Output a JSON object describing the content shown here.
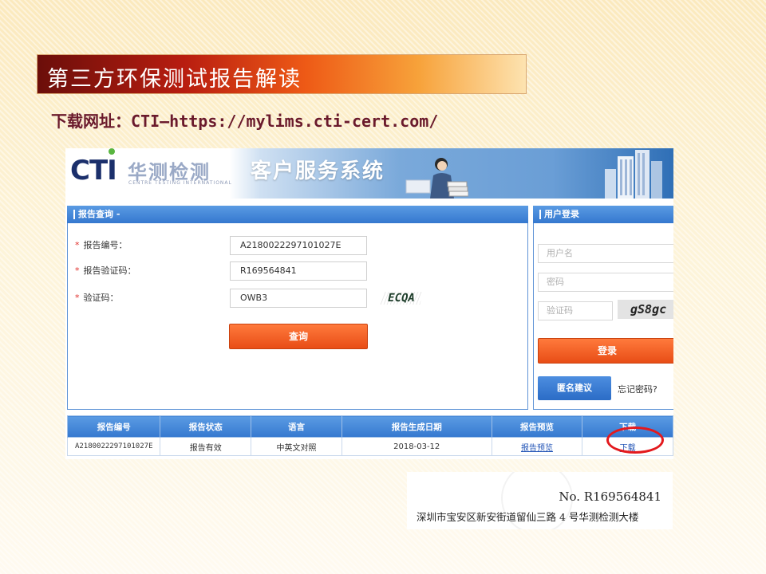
{
  "slide": {
    "title": "第三方环保测试报告解读",
    "subtitle": "下载网址：CTI—https://mylims.cti-cert.com/"
  },
  "site": {
    "logo_text": "CTI",
    "logo_cn": "华测检测",
    "logo_en": "CENTRE TESTING INTERNATIONAL",
    "banner_title": "客户服务系统"
  },
  "report_query": {
    "header": "报告查询 -",
    "fields": [
      {
        "label": "报告编号：",
        "value": "A2180022297101027E"
      },
      {
        "label": "报告验证码：",
        "value": "R169564841"
      },
      {
        "label": "验证码：",
        "value": "OWB3"
      }
    ],
    "captcha_text": "ECQA",
    "submit_label": "查询"
  },
  "user_login": {
    "header": "用户登录",
    "username_placeholder": "用户名",
    "password_placeholder": "密码",
    "captcha_placeholder": "验证码",
    "captcha_text": "gS8gc",
    "login_label": "登录",
    "anonymous_label": "匿名建议",
    "forgot_label": "忘记密码?"
  },
  "results": {
    "columns": [
      "报告编号",
      "报告状态",
      "语言",
      "报告生成日期",
      "报告预览",
      "下载"
    ],
    "rows": [
      {
        "report_no": "A2180022297101027E",
        "status": "报告有效",
        "language": "中英文对照",
        "date": "2018-03-12",
        "preview": "报告预览",
        "download": "下载"
      }
    ]
  },
  "certificate": {
    "number": "No. R169564841",
    "address": "深圳市宝安区新安街道留仙三路 4 号华测检测大楼"
  },
  "colors": {
    "title_gradient_start": "#6b0e0a",
    "title_gradient_end": "#fde3b0",
    "panel_blue": "#3578cf",
    "button_orange": "#e84d16",
    "highlight_circle": "#e3191d"
  }
}
